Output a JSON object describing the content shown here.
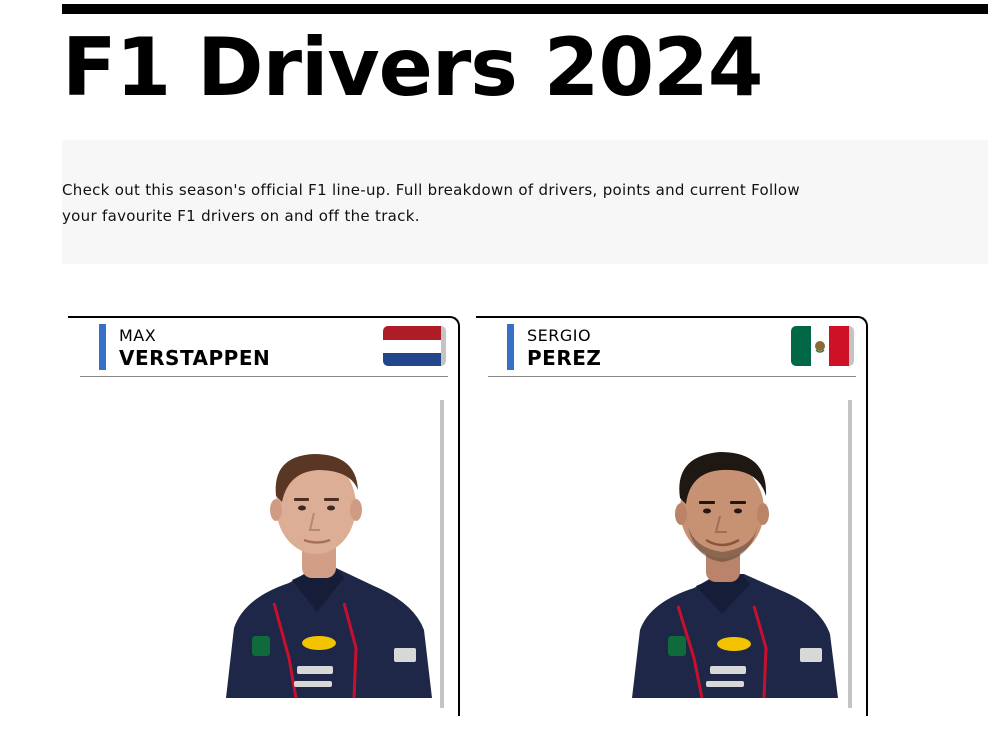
{
  "page": {
    "title": "F1 Drivers 2024",
    "intro": "Check out this season's official F1 line-up. Full breakdown of drivers, points and current Follow your favourite F1 drivers on and off the track."
  },
  "colors": {
    "team_accent": "#3671c6",
    "suit": "#1e2748",
    "background_band": "#f7f7f7"
  },
  "drivers": [
    {
      "first_name": "MAX",
      "last_name": "VERSTAPPEN",
      "flag_icon": "netherlands-flag-icon",
      "photo": "max-verstappen-portrait"
    },
    {
      "first_name": "SERGIO",
      "last_name": "PEREZ",
      "flag_icon": "mexico-flag-icon",
      "photo": "sergio-perez-portrait"
    }
  ]
}
